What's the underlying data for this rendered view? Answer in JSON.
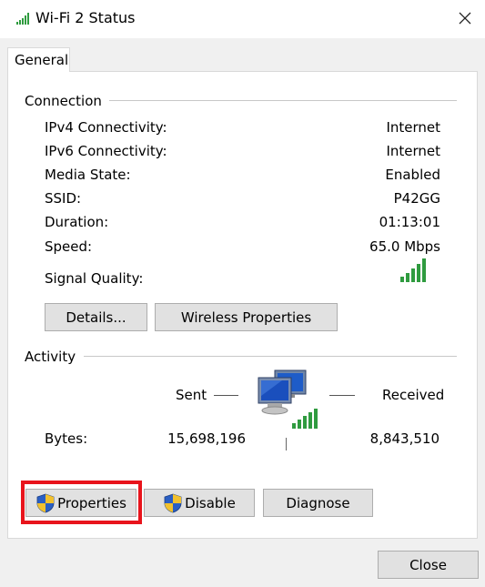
{
  "window": {
    "title": "Wi-Fi 2 Status",
    "icon": "wifi-signal-icon",
    "close_icon": "close-icon"
  },
  "tabs": [
    {
      "label": "General",
      "selected": true
    }
  ],
  "connection": {
    "heading": "Connection",
    "rows": [
      {
        "label": "IPv4 Connectivity:",
        "value": "Internet"
      },
      {
        "label": "IPv6 Connectivity:",
        "value": "Internet"
      },
      {
        "label": "Media State:",
        "value": "Enabled"
      },
      {
        "label": "SSID:",
        "value": "P42GG"
      },
      {
        "label": "Duration:",
        "value": "01:13:01"
      },
      {
        "label": "Speed:",
        "value": "65.0 Mbps"
      }
    ],
    "signal_quality_label": "Signal Quality:",
    "signal_quality_bars": 5,
    "details_button": "Details...",
    "wireless_properties_button": "Wireless Properties"
  },
  "activity": {
    "heading": "Activity",
    "sent_label": "Sent",
    "received_label": "Received",
    "bytes_label": "Bytes:",
    "bytes_sent": "15,698,196",
    "bytes_received": "8,843,510",
    "network_icon": "network-computers-icon"
  },
  "actions": {
    "properties_button": "Properties",
    "disable_button": "Disable",
    "diagnose_button": "Diagnose",
    "shield_icon": "uac-shield-icon",
    "highlight_color": "#e8141c"
  },
  "footer": {
    "close_button": "Close"
  },
  "colors": {
    "signal_green": "#2f9b3f",
    "window_bg": "#f0f0f0",
    "panel_bg": "#ffffff"
  }
}
